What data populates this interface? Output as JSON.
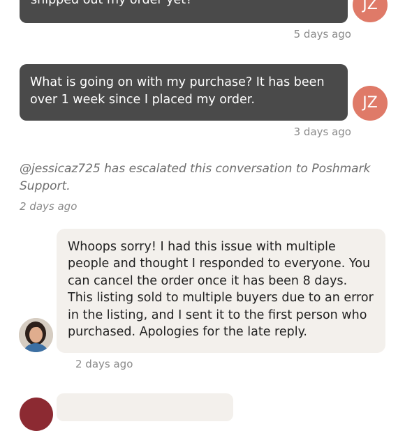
{
  "messages": [
    {
      "text": "shipped out my order yet?",
      "time": "5 days ago",
      "avatar_initials": "JZ"
    },
    {
      "text": "What is going on with my purchase? It has been over 1 week since I placed my order.",
      "time": "3 days ago",
      "avatar_initials": "JZ"
    }
  ],
  "system_event": {
    "text": "@jessicaz725 has escalated this conversation to Poshmark Support.",
    "time": "2 days ago"
  },
  "seller_message": {
    "text": "Whoops sorry! I had this issue with multiple people and thought I responded to everyone. You can cancel the order once it has been 8 days. This listing sold to multiple buyers due to an error in the listing, and I sent it to the first person who purchased. Apologies for the late reply.",
    "time": "2 days ago"
  },
  "colors": {
    "dark_bubble": "#4a4a4a",
    "light_bubble": "#f3f0ec",
    "buyer_avatar": "#df7a68",
    "next_avatar": "#8c2a32"
  }
}
